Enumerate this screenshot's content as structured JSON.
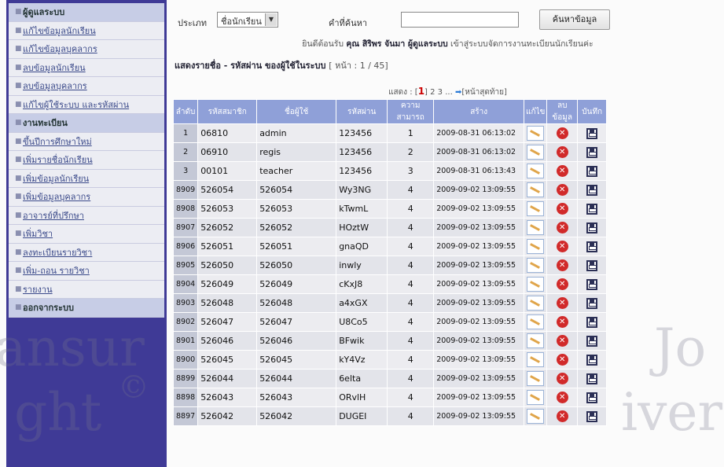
{
  "sidebar": {
    "items": [
      {
        "label": "ผู้ดูแลระบบ",
        "type": "header"
      },
      {
        "label": "แก้ไขข้อมูลนักเรียน",
        "type": "link"
      },
      {
        "label": "แก้ไขข้อมูลบุคลากร",
        "type": "link"
      },
      {
        "label": "ลบข้อมูลนักเรียน",
        "type": "link"
      },
      {
        "label": "ลบข้อมูลบุคลากร",
        "type": "link"
      },
      {
        "label": "แก้ไขผู้ใช้ระบบ และรหัสผ่าน",
        "type": "link"
      },
      {
        "label": "งานทะเบียน",
        "type": "header"
      },
      {
        "label": "ขึ้นปีการศึกษาใหม่",
        "type": "link"
      },
      {
        "label": "เพิ่มรายชื่อนักเรียน",
        "type": "link"
      },
      {
        "label": "เพิ่มข้อมูลนักเรียน",
        "type": "link"
      },
      {
        "label": "เพิ่มข้อมูลบุคลากร",
        "type": "link"
      },
      {
        "label": "อาจารย์ที่ปรึกษา",
        "type": "link"
      },
      {
        "label": "เพิ่มวิชา",
        "type": "link"
      },
      {
        "label": "ลงทะเบียนรายวิชา",
        "type": "link"
      },
      {
        "label": "เพิ่ม-ถอน รายวิชา",
        "type": "link"
      },
      {
        "label": "รายงาน",
        "type": "link"
      },
      {
        "label": "ออกจากระบบ",
        "type": "header"
      }
    ]
  },
  "search": {
    "type_label": "ประเภท",
    "type_selected": "ชื่อนักเรียน",
    "keyword_label": "คำที่ค้นหา",
    "keyword_value": "",
    "button_label": "ค้นหาข้อมูล"
  },
  "welcome": {
    "prefix": "ยินดีต้อนรับ",
    "name": "คุณ สิริพร จันมา ผู้ดูแลระบบ",
    "suffix": "เข้าสู่ระบบจัดการงานทะเบียนนักเรียนค่ะ"
  },
  "list": {
    "title": "แสดงรายชื่อ - รหัสผ่าน ของผู้ใช้ในระบบ",
    "page_info": "[ หน้า : 1 / 45]"
  },
  "pager": {
    "show_label": "แสดง :",
    "current": "1",
    "others": "2 3 ...",
    "last_label": "หน้าสุดท้าย"
  },
  "table": {
    "columns": [
      "ลำดับ",
      "รหัสสมาชิก",
      "ชื่อผู้ใช้",
      "รหัสผ่าน",
      "ความสามารถ",
      "สร้าง",
      "แก้ไข",
      "ลบข้อมูล",
      "บันทึก"
    ],
    "rows": [
      {
        "idx": "1",
        "member_id": "06810",
        "username": "admin",
        "password": "123456",
        "level": "1",
        "created": "2009-08-31 06:13:02"
      },
      {
        "idx": "2",
        "member_id": "06910",
        "username": "regis",
        "password": "123456",
        "level": "2",
        "created": "2009-08-31 06:13:02"
      },
      {
        "idx": "3",
        "member_id": "00101",
        "username": "teacher",
        "password": "123456",
        "level": "3",
        "created": "2009-08-31 06:13:43"
      },
      {
        "idx": "8909",
        "member_id": "526054",
        "username": "526054",
        "password": "Wy3NG",
        "level": "4",
        "created": "2009-09-02 13:09:55"
      },
      {
        "idx": "8908",
        "member_id": "526053",
        "username": "526053",
        "password": "kTwmL",
        "level": "4",
        "created": "2009-09-02 13:09:55"
      },
      {
        "idx": "8907",
        "member_id": "526052",
        "username": "526052",
        "password": "HOztW",
        "level": "4",
        "created": "2009-09-02 13:09:55"
      },
      {
        "idx": "8906",
        "member_id": "526051",
        "username": "526051",
        "password": "gnaQD",
        "level": "4",
        "created": "2009-09-02 13:09:55"
      },
      {
        "idx": "8905",
        "member_id": "526050",
        "username": "526050",
        "password": "inwly",
        "level": "4",
        "created": "2009-09-02 13:09:55"
      },
      {
        "idx": "8904",
        "member_id": "526049",
        "username": "526049",
        "password": "cKxJ8",
        "level": "4",
        "created": "2009-09-02 13:09:55"
      },
      {
        "idx": "8903",
        "member_id": "526048",
        "username": "526048",
        "password": "a4xGX",
        "level": "4",
        "created": "2009-09-02 13:09:55"
      },
      {
        "idx": "8902",
        "member_id": "526047",
        "username": "526047",
        "password": "U8Co5",
        "level": "4",
        "created": "2009-09-02 13:09:55"
      },
      {
        "idx": "8901",
        "member_id": "526046",
        "username": "526046",
        "password": "BFwik",
        "level": "4",
        "created": "2009-09-02 13:09:55"
      },
      {
        "idx": "8900",
        "member_id": "526045",
        "username": "526045",
        "password": "kY4Vz",
        "level": "4",
        "created": "2009-09-02 13:09:55"
      },
      {
        "idx": "8899",
        "member_id": "526044",
        "username": "526044",
        "password": "6elta",
        "level": "4",
        "created": "2009-09-02 13:09:55"
      },
      {
        "idx": "8898",
        "member_id": "526043",
        "username": "526043",
        "password": "ORvlH",
        "level": "4",
        "created": "2009-09-02 13:09:55"
      },
      {
        "idx": "8897",
        "member_id": "526042",
        "username": "526042",
        "password": "DUGEI",
        "level": "4",
        "created": "2009-09-02 13:09:55"
      }
    ]
  },
  "watermark": {
    "left_text": "ansur",
    "left_text2": "ght",
    "right_text": "Jo",
    "right_text2": "iver",
    "copyright": "©"
  },
  "colors": {
    "sidebar_bg": "#3f3a96",
    "header_bg": "#8fa0d8",
    "delete_red": "#d12a2a"
  }
}
